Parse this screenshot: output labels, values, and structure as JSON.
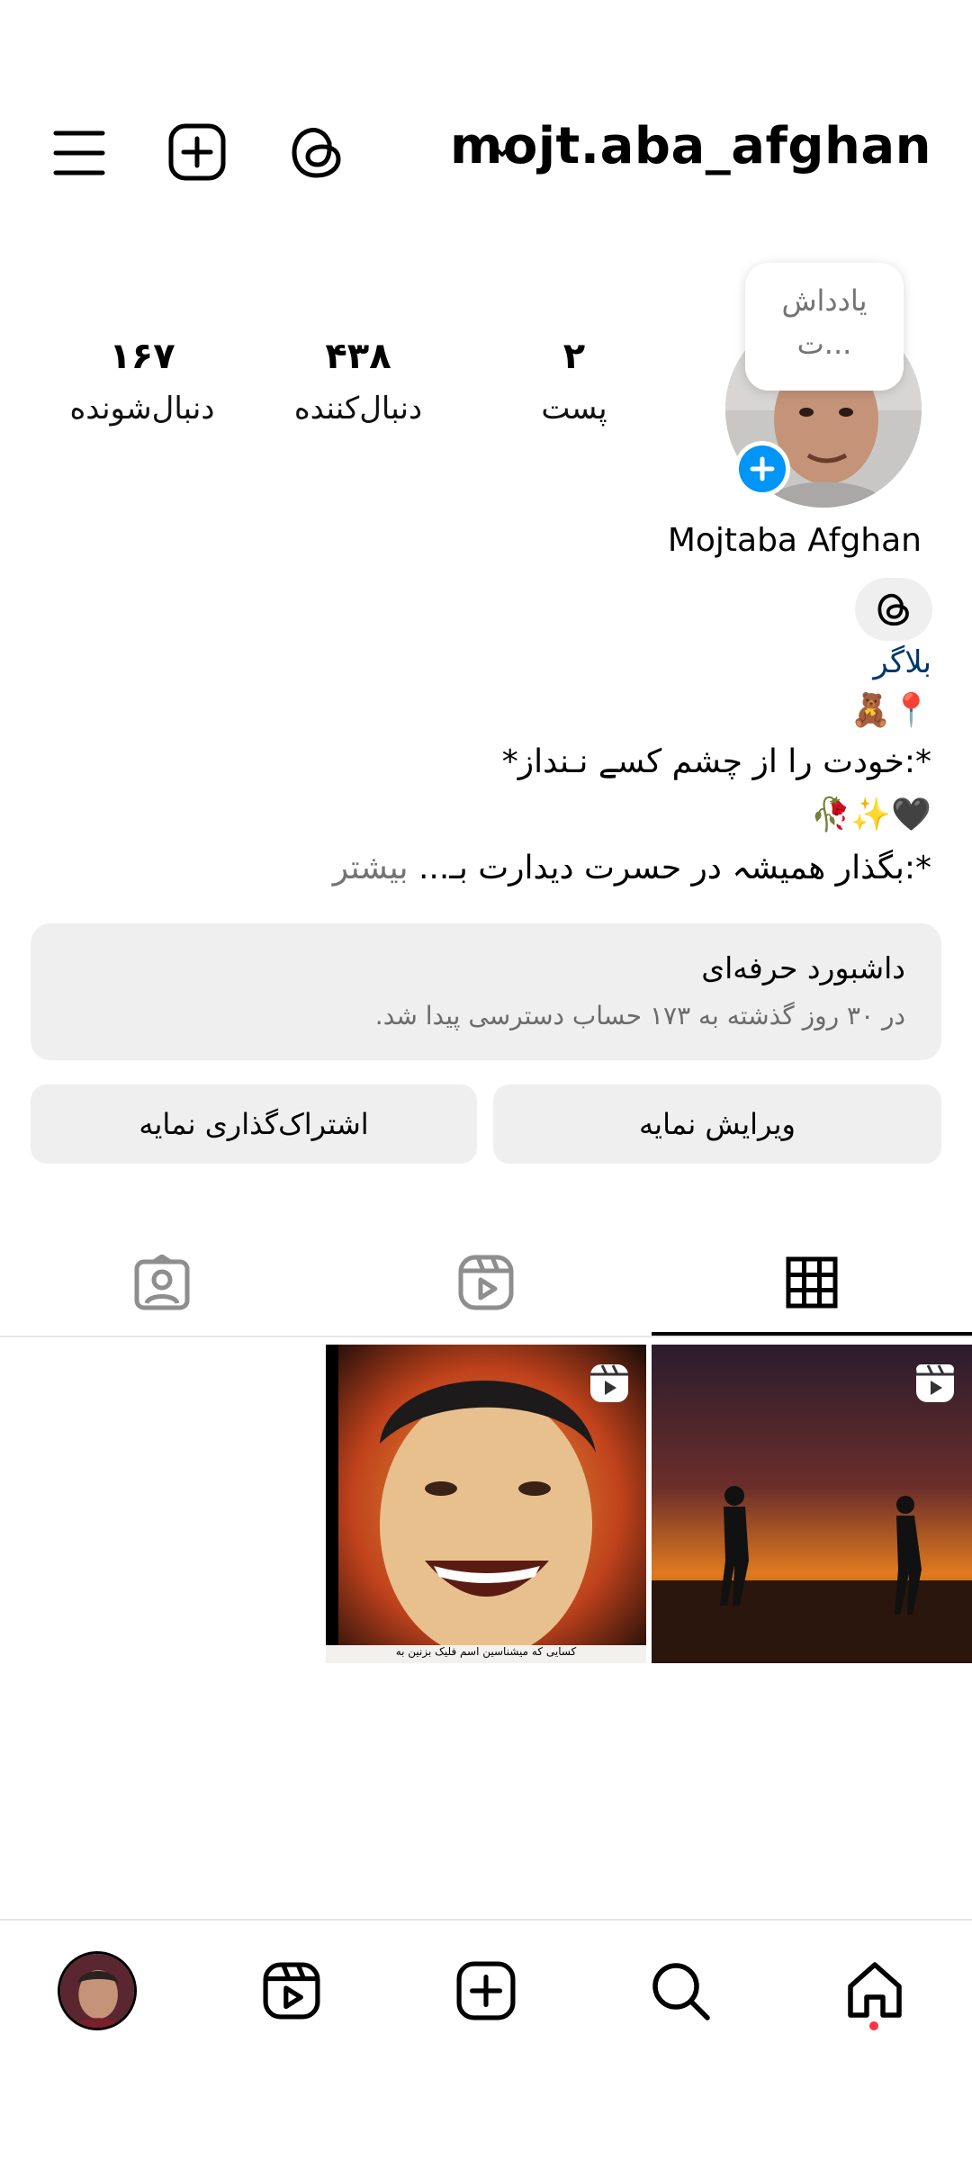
{
  "header": {
    "username": "mojt.aba_afghan"
  },
  "note_bubble": {
    "text_line1": "یادداش",
    "text_line2": "ت..."
  },
  "stats": [
    {
      "value": "۲",
      "label": "پست"
    },
    {
      "value": "۴۳۸",
      "label": "دنبال‌کننده"
    },
    {
      "value": "۱۶۷",
      "label": "دنبال‌شونده"
    }
  ],
  "profile": {
    "name": "Mojtaba Afghan",
    "category": "بلاگر",
    "bio_line1": "📍🧸",
    "bio_line2": "*:خودت را از چشم کسے نـنداز*",
    "bio_line3": "🖤✨🥀",
    "bio_line4": "*:بگذار همیشہ در حسرت دیدارت بـ...",
    "bio_more": "بیشتر"
  },
  "dashboard": {
    "title": "داشبورد حرفه‌ای",
    "subtitle": "در ۳۰ روز گذشته به ۱۷۳ حساب دسترسی پیدا شد."
  },
  "actions": {
    "edit": "ویرایش نمایه",
    "share": "اشتراک‌گذاری نمایه"
  },
  "grid": {
    "thumb2_caption": "کسایی که میشناسین اسم فلیک بزنین به"
  },
  "colors": {
    "accent_blue": "#0095f6",
    "link_blue": "#00376b",
    "notification_dot": "#ff3040"
  }
}
